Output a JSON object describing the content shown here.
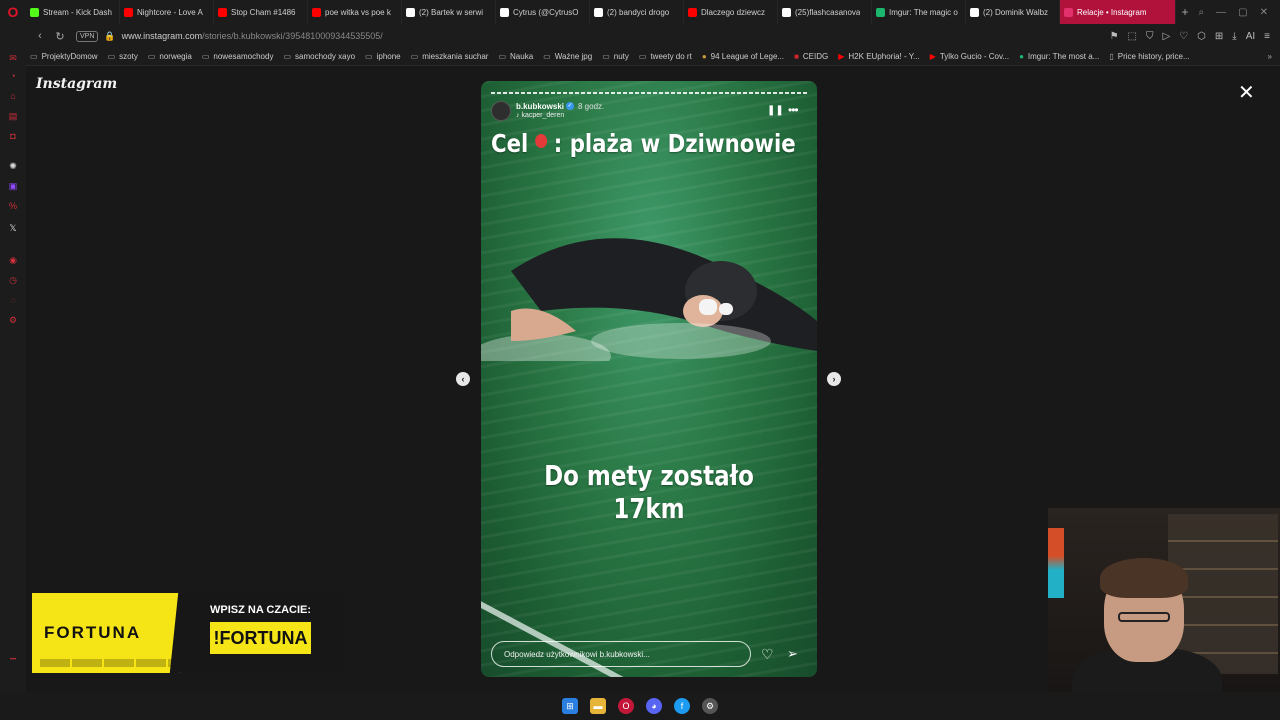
{
  "browser": {
    "tabs": [
      {
        "label": "Stream - Kick Dash",
        "color": "#53fc18"
      },
      {
        "label": "Nightcore - Love A",
        "color": "#ff0000"
      },
      {
        "label": "Stop Cham #1486",
        "color": "#ff0000"
      },
      {
        "label": "poe witka vs poe k",
        "color": "#ff0000"
      },
      {
        "label": "(2) Bartek w serwi",
        "color": "#ffffff"
      },
      {
        "label": "Cytrus (@CytrusO",
        "color": "#ffffff"
      },
      {
        "label": "(2) bandyci drogo",
        "color": "#ffffff"
      },
      {
        "label": "Dlaczego dziewcz",
        "color": "#ff0000"
      },
      {
        "label": "(25)flashcasanova",
        "color": "#ffffff"
      },
      {
        "label": "Imgur: The magic o",
        "color": "#1bb76e"
      },
      {
        "label": "(2) Dominik Walbz",
        "color": "#ffffff"
      }
    ],
    "active_tab": {
      "label": "Relacje • Instagram",
      "color": "#e1306c"
    },
    "url_host": "www.instagram.com",
    "url_path": "/stories/b.kubkowski/3954810009344535505/",
    "vpn_label": "VPN",
    "ai_label": "AI",
    "bookmarks": [
      {
        "label": "ProjektyDomow",
        "icon": "folder-icon"
      },
      {
        "label": "szoty",
        "icon": "folder-icon"
      },
      {
        "label": "norwegia",
        "icon": "folder-icon"
      },
      {
        "label": "nowesamochody",
        "icon": "folder-icon"
      },
      {
        "label": "samochody xayo",
        "icon": "folder-icon"
      },
      {
        "label": "iphone",
        "icon": "folder-icon"
      },
      {
        "label": "mieszkania suchar",
        "icon": "folder-icon"
      },
      {
        "label": "Nauka",
        "icon": "folder-icon"
      },
      {
        "label": "Ważne jpg",
        "icon": "folder-icon"
      },
      {
        "label": "nuty",
        "icon": "folder-icon"
      },
      {
        "label": "tweety do rt",
        "icon": "folder-icon"
      },
      {
        "label": "94 League of Lege...",
        "icon": "lol-icon"
      },
      {
        "label": "CEIDG",
        "icon": "ceidg-icon"
      },
      {
        "label": "H2K EUphoria! - Y...",
        "icon": "youtube-icon"
      },
      {
        "label": "Tylko Gucio - Cov...",
        "icon": "youtube-icon"
      },
      {
        "label": "Imgur: The most a...",
        "icon": "imgur-icon"
      },
      {
        "label": "Price history, price...",
        "icon": "page-icon"
      }
    ]
  },
  "instagram": {
    "logo": "Instagram",
    "story": {
      "username": "b.kubkowski",
      "time": "8 godz.",
      "music": "kacper_deren",
      "caption_top_left": "Cel",
      "caption_top_right": ": plaża w Dziwnowie",
      "caption_mid": "Do mety zostało 17km",
      "reply_placeholder": "Odpowiedz użytkownikowi b.kubkowski..."
    }
  },
  "overlay": {
    "fortuna_brand": "FORTUNA",
    "fortuna_cta": "WPISZ NA CZACIE:",
    "fortuna_command": "!FORTUNA"
  }
}
